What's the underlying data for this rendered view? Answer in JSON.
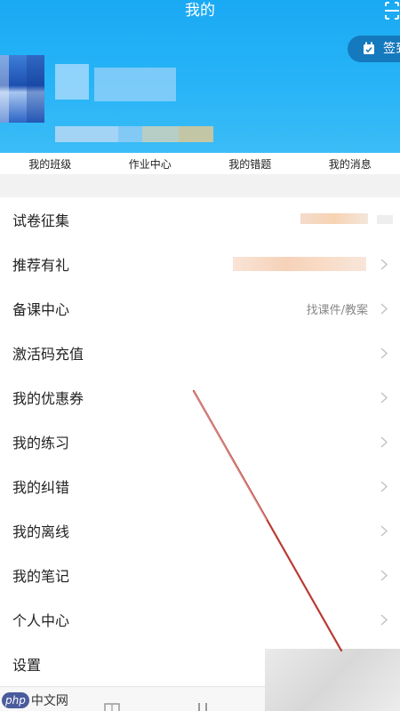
{
  "header": {
    "title": "我的",
    "checkin_label": "签到"
  },
  "tabs": [
    {
      "label": "我的班级"
    },
    {
      "label": "作业中心"
    },
    {
      "label": "我的错题"
    },
    {
      "label": "我的消息"
    }
  ],
  "menu": [
    {
      "label": "试卷征集",
      "value": ""
    },
    {
      "label": "推荐有礼",
      "value": ""
    },
    {
      "label": "备课中心",
      "value": "找课件/教案"
    },
    {
      "label": "激活码充值",
      "value": ""
    },
    {
      "label": "我的优惠券",
      "value": ""
    },
    {
      "label": "我的练习",
      "value": ""
    },
    {
      "label": "我的纠错",
      "value": ""
    },
    {
      "label": "我的离线",
      "value": ""
    },
    {
      "label": "我的笔记",
      "value": ""
    },
    {
      "label": "个人中心",
      "value": ""
    },
    {
      "label": "设置",
      "value": ""
    }
  ],
  "watermark": {
    "badge": "php",
    "text": "中文网"
  },
  "colors": {
    "header_blue": "#1aa9f3",
    "checkin_bg": "#1579bd",
    "annotation_red": "#b3261e"
  },
  "icons": {
    "scan": "scan-icon",
    "checkin": "calendar-check-icon",
    "chevron": "chevron-right-icon"
  }
}
